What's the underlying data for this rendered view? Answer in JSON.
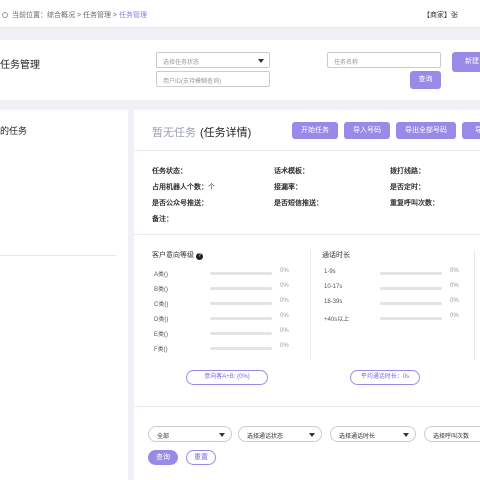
{
  "breadcrumb": {
    "prefix": "当前位置：",
    "parts": [
      "综合概况",
      "任务管理",
      "任务管理"
    ],
    "separator": " > "
  },
  "header": {
    "user": "【商家】张"
  },
  "filters": {
    "page_title": "任务管理",
    "status_select": "选择任务状态",
    "user_id_placeholder": "用户ID(支持模糊查询)",
    "task_name_placeholder": "任务名称",
    "query_label": "查询",
    "new_label": "新建"
  },
  "sidebar": {
    "heading": "的任务"
  },
  "main": {
    "title_muted": "暂无任务",
    "title": "(任务详情)",
    "toolbar": [
      "开始任务",
      "导入号码",
      "导出全部号码",
      "导出"
    ],
    "info": {
      "task_status": "任务状态：",
      "robot_count": "占用机器人个数：",
      "robot_count_unit": "个",
      "public_push": "是否公众号推送：",
      "remark": "备注：",
      "script_template": "话术模板：",
      "miss_rate": "接漏率：",
      "sms_push": "是否短信推送：",
      "dial_line": "拨打线路：",
      "scheduled": "是否定时：",
      "redial_count": "重复呼叫次数："
    },
    "intent": {
      "title": "客户意向等级",
      "help": "?",
      "rows": [
        {
          "label": "A类()",
          "pct": "0%",
          "value": 0
        },
        {
          "label": "B类()",
          "pct": "0%",
          "value": 0
        },
        {
          "label": "C类()",
          "pct": "0%",
          "value": 0
        },
        {
          "label": "D类()",
          "pct": "0%",
          "value": 0
        },
        {
          "label": "E类()",
          "pct": "0%",
          "value": 0
        },
        {
          "label": "F类()",
          "pct": "0%",
          "value": 0
        }
      ],
      "pill": "意向客A+B: (0%)"
    },
    "duration": {
      "title": "通话时长",
      "rows": [
        {
          "label": "1-9s",
          "pct": "0%",
          "value": 0
        },
        {
          "label": "10-17s",
          "pct": "0%",
          "value": 0
        },
        {
          "label": "18-39s",
          "pct": "0%",
          "value": 0
        },
        {
          "label": "+40s以上",
          "pct": "0%",
          "value": 0
        }
      ],
      "pill": "平均通话时长：0s"
    },
    "bottom": {
      "all": "全部",
      "call_status": "选择通话状态",
      "call_duration": "选择通话时长",
      "callback": "选择呼叫次数",
      "query": "查询",
      "reset": "重置"
    },
    "accent": "#9a8ae8"
  }
}
